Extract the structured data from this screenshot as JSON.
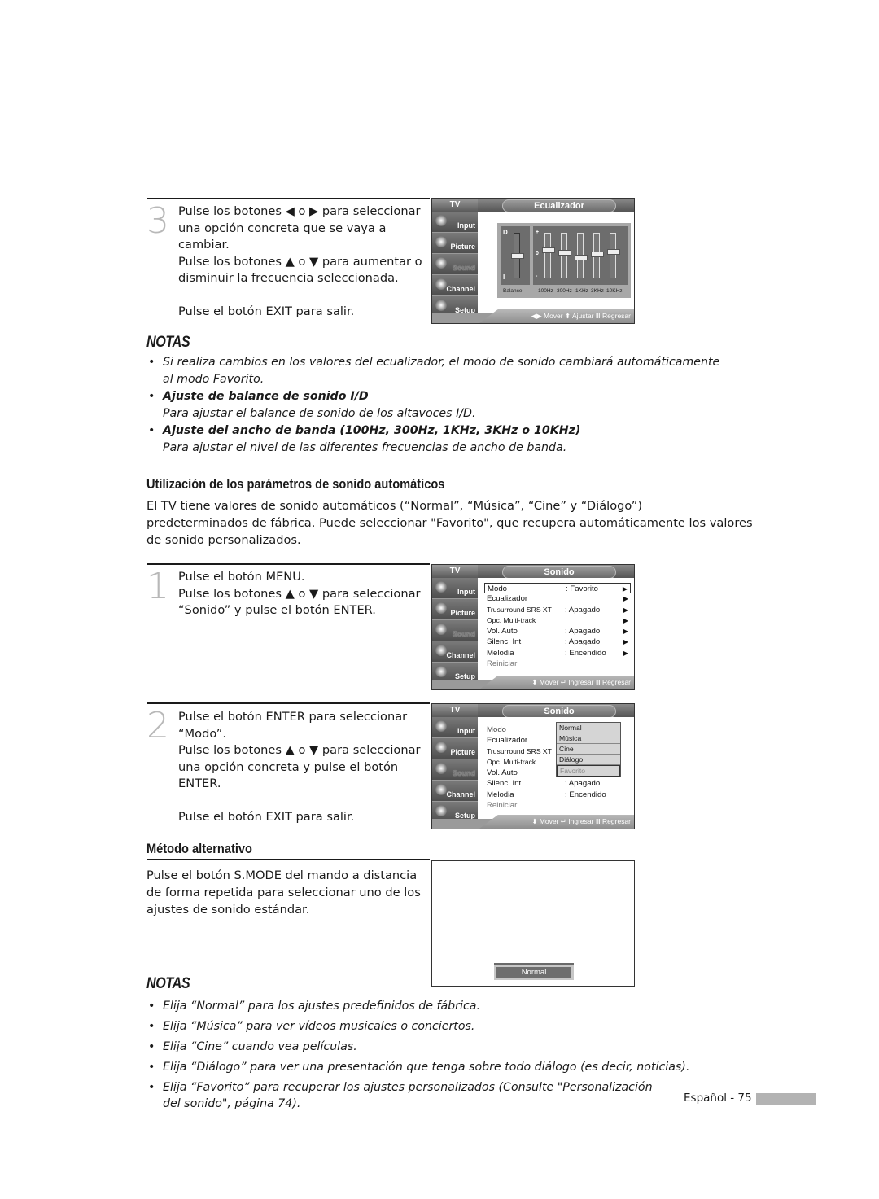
{
  "step3": {
    "number": "3",
    "lines": [
      "Pulse los botones ◀ o ▶ para seleccionar",
      "una opción concreta que se vaya a",
      "cambiar.",
      "Pulse los botones ▲ o ▼ para aumentar o",
      "disminuir la frecuencia seleccionada."
    ],
    "exit": "Pulse el botón EXIT para salir."
  },
  "osd_equalizer": {
    "tv_label": "TV",
    "title": "Ecualizador",
    "sidebar": [
      {
        "label": "Input",
        "icon": "input-icon"
      },
      {
        "label": "Picture",
        "icon": "picture-icon"
      },
      {
        "label": "Sound",
        "icon": "sound-icon",
        "active": true
      },
      {
        "label": "Channel",
        "icon": "channel-icon"
      },
      {
        "label": "Setup",
        "icon": "setup-icon"
      }
    ],
    "balance": {
      "label": "Balance",
      "top_mark": "D",
      "bottom_mark": "I",
      "level": 0.5
    },
    "plus_mark": "+",
    "zero_mark": "0",
    "minus_mark": "-",
    "bands": [
      {
        "label": "100Hz",
        "level": 0.63
      },
      {
        "label": "300Hz",
        "level": 0.57
      },
      {
        "label": "1KHz",
        "level": 0.46
      },
      {
        "label": "3KHz",
        "level": 0.53
      },
      {
        "label": "10KHz",
        "level": 0.59
      }
    ],
    "hint": "◀▶ Mover  ⬍ Ajustar  Ⅲ Regresar"
  },
  "notas1": {
    "title": "NOTAS",
    "items": [
      {
        "text": "Si realiza cambios en los valores del ecualizador, el modo de sonido cambiará automáticamente",
        "text2": "al modo Favorito."
      },
      {
        "bold": "Ajuste de balance de sonido I/D",
        "text": "Para ajustar el balance de sonido de los altavoces I/D."
      },
      {
        "bold": "Ajuste del ancho de banda (100Hz, 300Hz, 1KHz, 3KHz o 10KHz)",
        "text": "Para ajustar el nivel de las diferentes frecuencias de ancho de banda."
      }
    ]
  },
  "section_auto": {
    "heading": "Utilización de los parámetros de sonido automáticos",
    "para": [
      "El TV tiene valores de sonido automáticos (“Normal”, “Música”, “Cine” y “Diálogo”)",
      "predeterminados de fábrica. Puede seleccionar \"Favorito\", que recupera automáticamente los valores",
      "de sonido personalizados."
    ]
  },
  "step1": {
    "number": "1",
    "lines": [
      "Pulse el botón MENU.",
      "Pulse los botones ▲ o ▼ para seleccionar",
      "“Sonido” y pulse el botón ENTER."
    ]
  },
  "osd_sonido1": {
    "tv_label": "TV",
    "title": "Sonido",
    "rows": [
      {
        "key": "Modo",
        "value": ": Favorito",
        "arrow": "▶",
        "selected": true
      },
      {
        "key": "Ecualizador",
        "value": "",
        "arrow": "▶"
      },
      {
        "key": "Trusurround SRS XT",
        "value": ": Apagado",
        "arrow": "▶"
      },
      {
        "key": "Opc. Multi-track",
        "value": "",
        "arrow": "▶"
      },
      {
        "key": "Vol. Auto",
        "value": ": Apagado",
        "arrow": "▶"
      },
      {
        "key": "Silenc. Int",
        "value": ": Apagado",
        "arrow": "▶"
      },
      {
        "key": "Melodia",
        "value": ": Encendido",
        "arrow": "▶"
      },
      {
        "key": "Reiniciar",
        "value": "",
        "arrow": "",
        "dim": true
      }
    ],
    "hint": "⬍ Mover  ↵ Ingresar  Ⅲ Regresar"
  },
  "step2": {
    "number": "2",
    "lines": [
      "Pulse el botón ENTER para seleccionar",
      "“Modo”.",
      "Pulse los botones ▲ o ▼ para seleccionar",
      "una opción concreta y pulse el botón",
      "ENTER."
    ],
    "exit": "Pulse el botón EXIT para salir."
  },
  "osd_sonido2": {
    "tv_label": "TV",
    "title": "Sonido",
    "rows": [
      {
        "key": "Modo",
        "value": ""
      },
      {
        "key": "Ecualizador",
        "value": ""
      },
      {
        "key": "Trusurround SRS XT",
        "value": ""
      },
      {
        "key": "Opc. Multi-track",
        "value": ""
      },
      {
        "key": "Vol. Auto",
        "value": ""
      },
      {
        "key": "Silenc. Int",
        "value": ": Apagado"
      },
      {
        "key": "Melodia",
        "value": ": Encendido"
      },
      {
        "key": "Reiniciar",
        "value": "",
        "dim": true
      }
    ],
    "dropdown": [
      "Normal",
      "Música",
      "Cine",
      "Diálogo",
      "Favorito"
    ],
    "dropdown_current": "Favorito",
    "hint": "⬍ Mover  ↵ Ingresar  Ⅲ Regresar"
  },
  "section_alt": {
    "heading": "Método alternativo",
    "para": [
      "Pulse el botón S.MODE del mando a distancia",
      "de forma repetida para seleccionar uno de los",
      "ajustes de sonido estándar."
    ],
    "osd_label": "Normal"
  },
  "notas2": {
    "title": "NOTAS",
    "items": [
      "Elija “Normal” para los ajustes predefinidos de fábrica.",
      "Elija “Música” para ver vídeos musicales o conciertos.",
      "Elija “Cine” cuando vea películas.",
      "Elija “Diálogo” para ver una presentación que tenga sobre todo diálogo (es decir, noticias).",
      "Elija “Favorito” para recuperar los ajustes personalizados (Consulte \"Personalización"
    ],
    "last_line": "del sonido\", página 74)."
  },
  "footer": {
    "text": "Español - 75"
  }
}
